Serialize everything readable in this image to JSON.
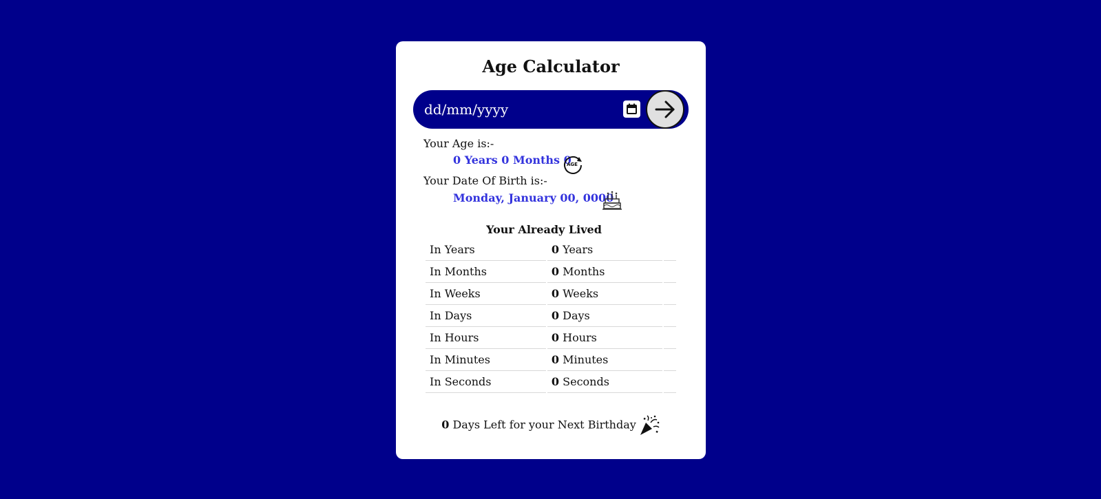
{
  "app": {
    "title": "Age Calculator"
  },
  "date_input": {
    "placeholder": "dd/mm/yyyy",
    "calendar_icon": "calendar-icon",
    "submit_icon": "arrow-right-icon"
  },
  "age": {
    "label": "Your Age is:-",
    "value": "0 Years 0 Months 0",
    "icon": "age-icon"
  },
  "dob": {
    "label": "Your Date Of Birth is:-",
    "value": "Monday, January 00, 0000",
    "icon": "cake-icon"
  },
  "lived": {
    "title": "Your Already Lived",
    "rows": [
      {
        "label": "In Years",
        "value": "0",
        "unit": "Years"
      },
      {
        "label": "In Months",
        "value": "0",
        "unit": "Months"
      },
      {
        "label": "In Weeks",
        "value": "0",
        "unit": "Weeks"
      },
      {
        "label": "In Days",
        "value": "0",
        "unit": "Days"
      },
      {
        "label": "In Hours",
        "value": "0",
        "unit": "Hours"
      },
      {
        "label": "In Minutes",
        "value": "0",
        "unit": "Minutes"
      },
      {
        "label": "In Seconds",
        "value": "0",
        "unit": "Seconds"
      }
    ]
  },
  "next_birthday": {
    "days": "0",
    "text": "Days Left for your Next Birthday",
    "icon": "party-popper-icon"
  },
  "colors": {
    "background": "#00008b",
    "card": "#ffffff",
    "accent_value": "#3333dd"
  }
}
